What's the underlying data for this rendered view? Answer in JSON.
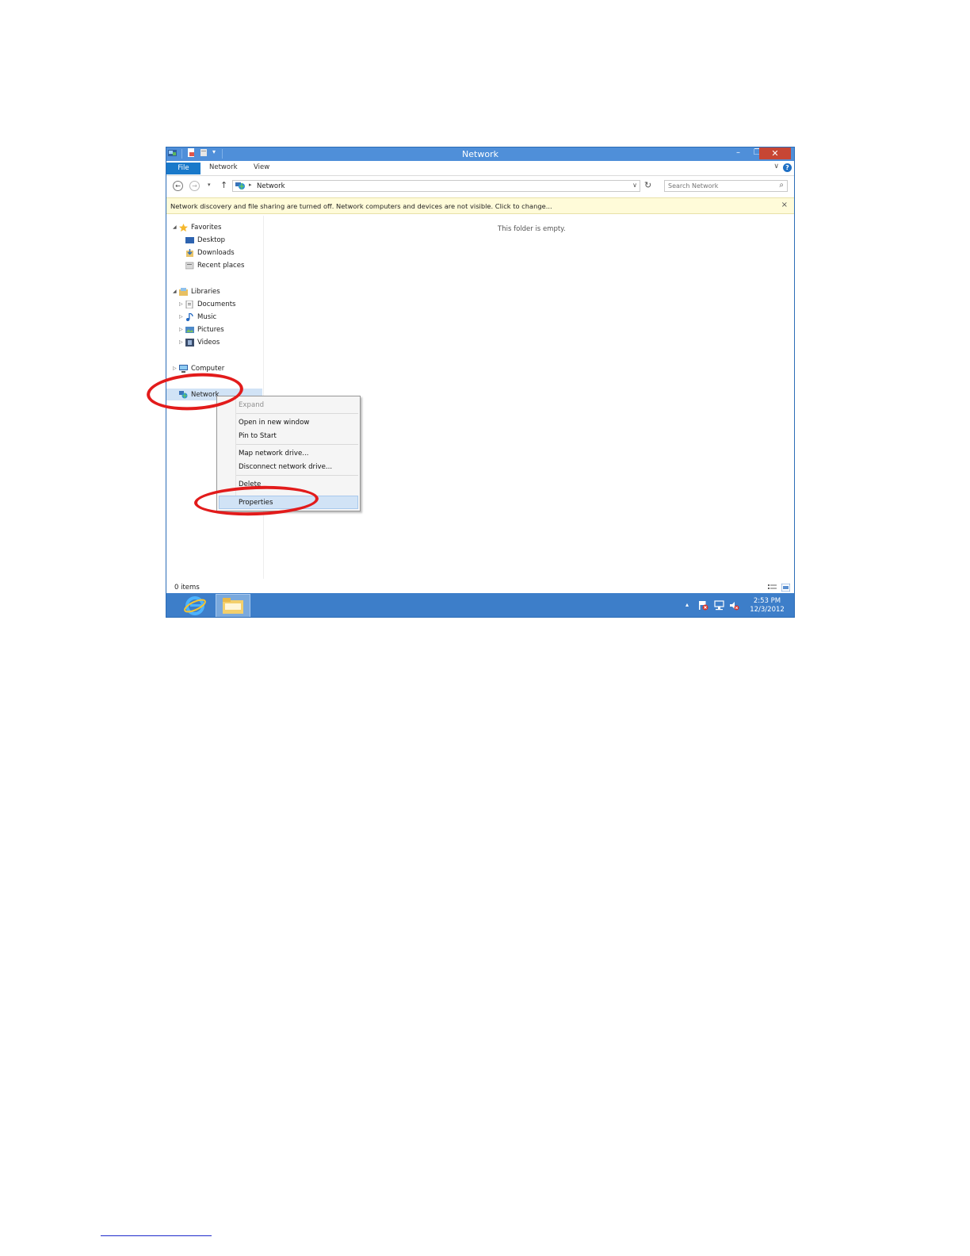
{
  "window": {
    "title": "Network",
    "controls": {
      "minimize": "–",
      "restore": "❐",
      "close": "✕"
    }
  },
  "ribbon": {
    "tabs": [
      "File",
      "Network",
      "View"
    ],
    "help": "?",
    "collapse": "∨"
  },
  "navigation": {
    "back": "←",
    "forward": "→",
    "history": "▾",
    "up": "↑",
    "address_sep": "▸",
    "address": "Network",
    "address_dropdown": "∨",
    "refresh": "↻",
    "search_placeholder": "Search Network",
    "search_icon": "⌕"
  },
  "infobar": {
    "message": "Network discovery and file sharing are turned off. Network computers and devices are not visible. Click to change...",
    "close": "×"
  },
  "navpane": {
    "favorites": {
      "label": "Favorites",
      "items": [
        "Desktop",
        "Downloads",
        "Recent places"
      ]
    },
    "libraries": {
      "label": "Libraries",
      "items": [
        "Documents",
        "Music",
        "Pictures",
        "Videos"
      ]
    },
    "computer": "Computer",
    "network": "Network"
  },
  "content": {
    "empty_message": "This folder is empty."
  },
  "status": {
    "items": "0 items"
  },
  "context_menu": {
    "expand": "Expand",
    "open_new_window": "Open in new window",
    "pin_to_start": "Pin to Start",
    "map_drive": "Map network drive...",
    "disconnect_drive": "Disconnect network drive...",
    "delete": "Delete",
    "properties": "Properties"
  },
  "taskbar": {
    "time": "2:53 PM",
    "date": "12/3/2012",
    "tray_arrow": "▴"
  },
  "colors": {
    "titlebar": "#4f8fd9",
    "file_tab": "#1979ca",
    "close_button": "#c74634",
    "infobar": "#fffbd9",
    "taskbar": "#3d7ec9",
    "annotation": "#e21b1b",
    "selection": "#d1e3f6"
  }
}
